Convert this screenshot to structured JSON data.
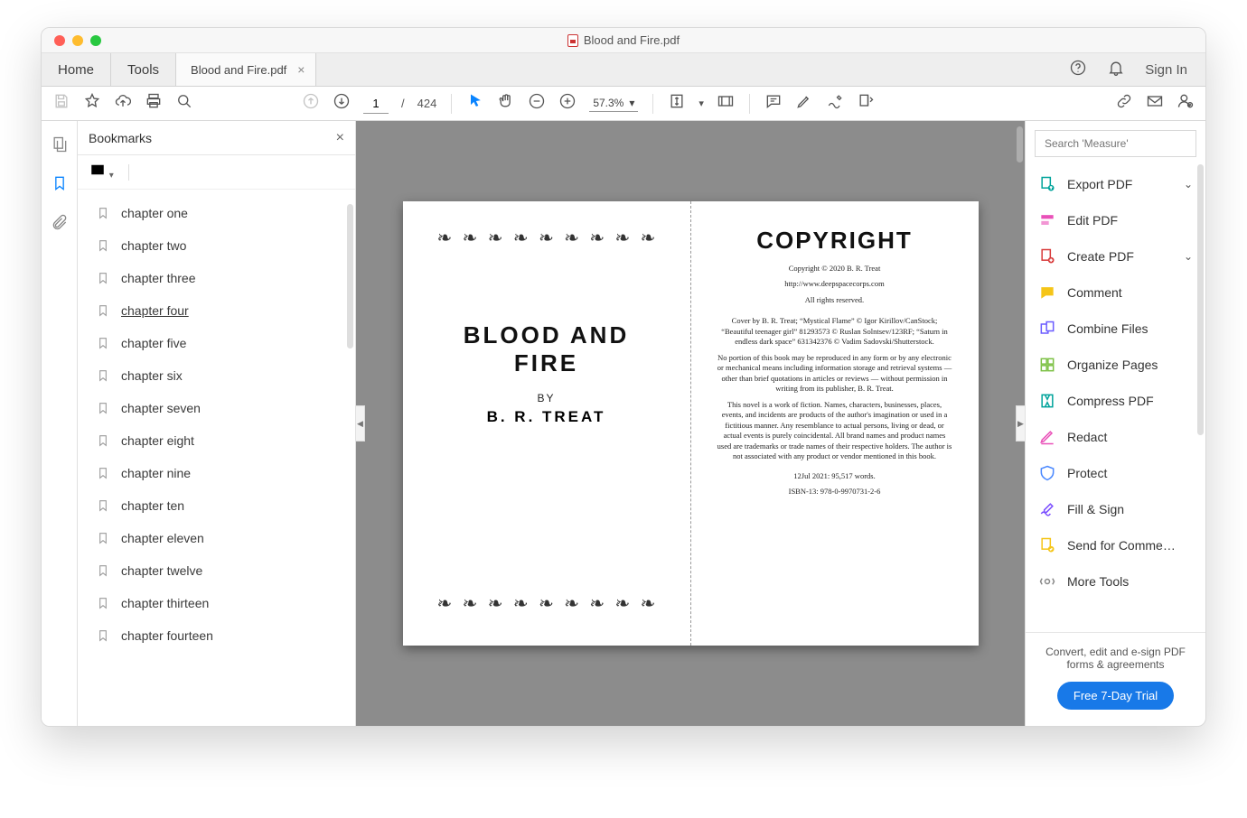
{
  "window": {
    "title": "Blood and Fire.pdf"
  },
  "tabs": {
    "home": "Home",
    "tools": "Tools",
    "doc": "Blood and Fire.pdf",
    "signin": "Sign In"
  },
  "toolbar": {
    "page_current": "1",
    "page_sep": "/",
    "page_total": "424",
    "zoom": "57.3%"
  },
  "bookmarks": {
    "title": "Bookmarks",
    "items": [
      "chapter one",
      "chapter two",
      "chapter three",
      "chapter four",
      "chapter five",
      "chapter six",
      "chapter seven",
      "chapter eight",
      "chapter nine",
      "chapter ten",
      "chapter eleven",
      "chapter twelve",
      "chapter thirteen",
      "chapter fourteen"
    ],
    "active_index": 3
  },
  "doc": {
    "left": {
      "title_line1": "BLOOD AND",
      "title_line2": "FIRE",
      "by": "BY",
      "author": "B. R. TREAT"
    },
    "right": {
      "head": "COPYRIGHT",
      "p1": "Copyright © 2020 B. R. Treat",
      "p2": "http://www.deepspacecorps.com",
      "p3": "All rights reserved.",
      "p4": "Cover by B. R. Treat; “Mystical Flame” © Igor Kirillov/CanStock; “Beautiful teenager girl” 81293573 © Ruslan Solntsev/123RF; “Saturn in endless dark space” 631342376 © Vadim Sadovski/Shutterstock.",
      "p5": "No portion of this book may be reproduced in any form or by any electronic or mechanical means including information storage and retrieval systems — other than brief quotations in articles or reviews — without permission in writing from its publisher, B. R. Treat.",
      "p6": "This novel is a work of fiction. Names, characters, businesses, places, events, and incidents are products of the author's imagination or used in a fictitious manner. Any resemblance to actual persons, living or dead, or actual events is purely coincidental. All brand names and product names used are trademarks or trade names of their respective holders. The author is not associated with any product or vendor mentioned in this book.",
      "p7": "12Jul 2021: 95,517 words.",
      "p8": "ISBN-13: 978-0-9970731-2-6"
    }
  },
  "right_panel": {
    "search_placeholder": "Search 'Measure'",
    "tools": [
      {
        "label": "Export PDF",
        "chev": true,
        "color": "#00a39b"
      },
      {
        "label": "Edit PDF",
        "chev": false,
        "color": "#e950b8"
      },
      {
        "label": "Create PDF",
        "chev": true,
        "color": "#d83b3b"
      },
      {
        "label": "Comment",
        "chev": false,
        "color": "#f5c518"
      },
      {
        "label": "Combine Files",
        "chev": false,
        "color": "#6b5cff"
      },
      {
        "label": "Organize Pages",
        "chev": false,
        "color": "#7bc043"
      },
      {
        "label": "Compress PDF",
        "chev": false,
        "color": "#00a39b"
      },
      {
        "label": "Redact",
        "chev": false,
        "color": "#e950b8"
      },
      {
        "label": "Protect",
        "chev": false,
        "color": "#4a88ff"
      },
      {
        "label": "Fill & Sign",
        "chev": false,
        "color": "#7a4dff"
      },
      {
        "label": "Send for Comme…",
        "chev": false,
        "color": "#f5c518"
      },
      {
        "label": "More Tools",
        "chev": false,
        "color": "#888"
      }
    ],
    "promo_line1": "Convert, edit and e-sign PDF",
    "promo_line2": "forms & agreements",
    "cta": "Free 7-Day Trial"
  }
}
